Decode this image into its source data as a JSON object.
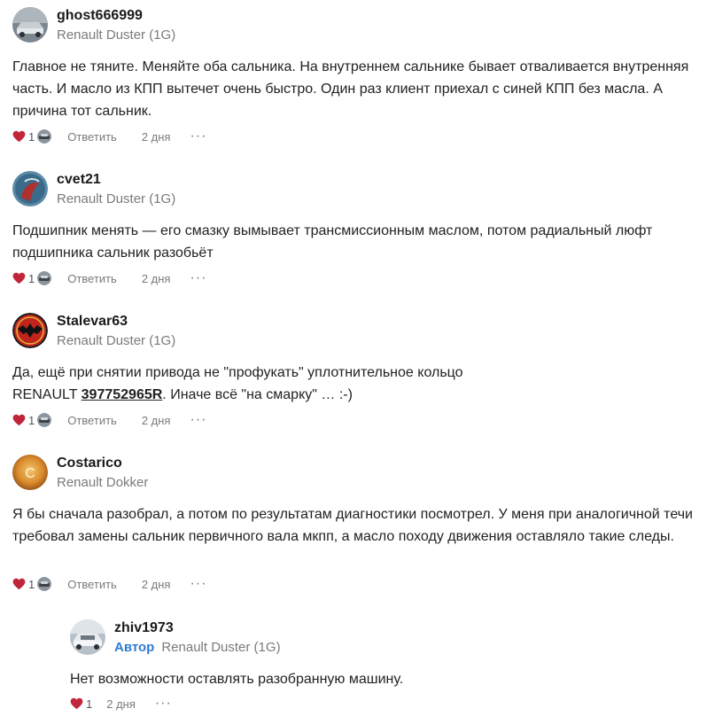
{
  "comments": [
    {
      "username": "ghost666999",
      "car": "Renault Duster (1G)",
      "text": "Главное не тяните. Меняйте оба сальника. На внутреннем сальнике бывает отваливается внутренняя часть. И масло из КПП вытечет очень быстро. Один раз клиент приехал с синей КПП без масла. А причина тот сальник.",
      "likes": "1",
      "reply_label": "Ответить",
      "date": "2 дня",
      "more": "···"
    },
    {
      "username": "cvet21",
      "car": "Renault Duster (1G)",
      "text": "Подшипник менять — его смазку вымывает трансмиссионным маслом, потом радиальный люфт подшипника сальник разобьёт",
      "likes": "1",
      "reply_label": "Ответить",
      "date": "2 дня",
      "more": "···"
    },
    {
      "username": "Stalevar63",
      "car": "Renault Duster (1G)",
      "text_line1": "Да, ещё при снятии привода не \"профукать\" уплотнительное кольцо",
      "text_prefix": "RENAULT ",
      "part_number": "397752965R",
      "text_suffix": ". Иначе всё \"на смарку\" … :-)",
      "likes": "1",
      "reply_label": "Ответить",
      "date": "2 дня",
      "more": "···"
    },
    {
      "username": "Costarico",
      "avatar_letter": "C",
      "car": "Renault Dokker",
      "text": "Я бы сначала разобрал, а потом по результатам диагностики посмотрел. У меня при аналогичной течи требовал замены сальник первичного вала мкпп, а масло походу движения оставляло такие следы.",
      "likes": "1",
      "reply_label": "Ответить",
      "date": "2 дня",
      "more": "···"
    },
    {
      "username": "zhiv1973",
      "author_badge": "Автор",
      "car": "Renault Duster (1G)",
      "text": "Нет возможности оставлять разобранную машину.",
      "likes": "1",
      "date": "2 дня",
      "more": "···"
    }
  ],
  "colors": {
    "heart": "#c0263a",
    "author_badge": "#2f7bd1",
    "muted": "#7a7a7a"
  }
}
